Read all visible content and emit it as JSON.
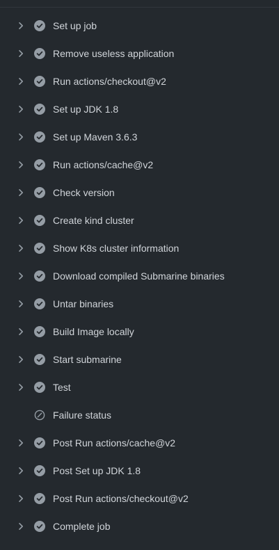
{
  "steps": [
    {
      "label": "Set up job",
      "status": "success",
      "expandable": true
    },
    {
      "label": "Remove useless application",
      "status": "success",
      "expandable": true
    },
    {
      "label": "Run actions/checkout@v2",
      "status": "success",
      "expandable": true
    },
    {
      "label": "Set up JDK 1.8",
      "status": "success",
      "expandable": true
    },
    {
      "label": "Set up Maven 3.6.3",
      "status": "success",
      "expandable": true
    },
    {
      "label": "Run actions/cache@v2",
      "status": "success",
      "expandable": true
    },
    {
      "label": "Check version",
      "status": "success",
      "expandable": true
    },
    {
      "label": "Create kind cluster",
      "status": "success",
      "expandable": true
    },
    {
      "label": "Show K8s cluster information",
      "status": "success",
      "expandable": true
    },
    {
      "label": "Download compiled Submarine binaries",
      "status": "success",
      "expandable": true
    },
    {
      "label": "Untar binaries",
      "status": "success",
      "expandable": true
    },
    {
      "label": "Build Image locally",
      "status": "success",
      "expandable": true
    },
    {
      "label": "Start submarine",
      "status": "success",
      "expandable": true
    },
    {
      "label": "Test",
      "status": "success",
      "expandable": true
    },
    {
      "label": "Failure status",
      "status": "skipped",
      "expandable": false
    },
    {
      "label": "Post Run actions/cache@v2",
      "status": "success",
      "expandable": true
    },
    {
      "label": "Post Set up JDK 1.8",
      "status": "success",
      "expandable": true
    },
    {
      "label": "Post Run actions/checkout@v2",
      "status": "success",
      "expandable": true
    },
    {
      "label": "Complete job",
      "status": "success",
      "expandable": true
    }
  ],
  "colors": {
    "background": "#24292e",
    "text": "#d1d5da",
    "icon": "#959da5",
    "divider": "#31363c"
  }
}
